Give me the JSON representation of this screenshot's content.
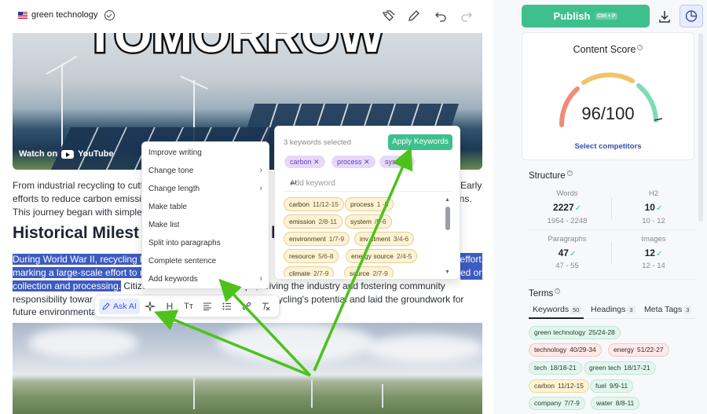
{
  "topbar": {
    "topic": "green technology"
  },
  "hero": {
    "sign_text": "TOMORROW",
    "watch_label": "Watch on",
    "youtube_label": "YouTube"
  },
  "article": {
    "intro_lines": [
      "From industrial recycling to cutti",
      "efforts to reduce carbon emissio",
      "This journey began with simple p"
    ],
    "intro_right": [
      "Early",
      "ons."
    ],
    "heading": "Historical Milest",
    "heading_tail": "l",
    "sel_lines": [
      "During World War II, recycling be",
      "marking a large-scale effort to m",
      "collection and processing."
    ],
    "sel_right": [
      "effort,",
      "ed on"
    ],
    "after_sel": " Citize",
    "line4_right": "pe, driving the industry and fostering community",
    "line5_left": "responsibility towar",
    "line5_right": "cycling's potential and laid the groundwork for",
    "line6_left": "future environmenta"
  },
  "toolbar": {
    "ask_ai_label": "Ask AI"
  },
  "context_menu": {
    "items": [
      {
        "label": "Improve writing",
        "submenu": false
      },
      {
        "label": "Change tone",
        "submenu": true
      },
      {
        "label": "Change length",
        "submenu": true
      },
      {
        "label": "Make table",
        "submenu": false
      },
      {
        "label": "Make list",
        "submenu": false
      },
      {
        "label": "Split into paragraphs",
        "submenu": false
      },
      {
        "label": "Complete sentence",
        "submenu": false
      },
      {
        "label": "Add keywords",
        "submenu": true
      }
    ]
  },
  "keywords_panel": {
    "count_text": "3 keywords selected",
    "apply_label": "Apply Keywords",
    "selected": [
      "carbon ✕",
      "process ✕",
      "syste ✕"
    ],
    "add_placeholder": "Add keyword",
    "chips": [
      {
        "name": "carbon",
        "range": "11/12-15"
      },
      {
        "name": "process",
        "range": "1 -5"
      },
      {
        "name": "emission",
        "range": "2/8-11"
      },
      {
        "name": "system",
        "range": "/5-6"
      },
      {
        "name": "environment",
        "range": "1/7-9"
      },
      {
        "name": "inv stment",
        "range": "3/4-6"
      },
      {
        "name": "resource",
        "range": "5/6-8"
      },
      {
        "name": "energy source",
        "range": "2/4-5"
      },
      {
        "name": "climate",
        "range": "2/7-9"
      },
      {
        "name": "source",
        "range": "2/7-9"
      }
    ]
  },
  "sidebar": {
    "publish_label": "Publish",
    "publish_shortcut": "Ctrl + P",
    "content_score_title": "Content Score",
    "score": "96/100",
    "competitors_label": "Select competitors",
    "structure_title": "Structure",
    "stats": [
      {
        "label": "Words",
        "value": "2227",
        "range": "1954 - 2248"
      },
      {
        "label": "H2",
        "value": "10",
        "range": "10 - 12"
      },
      {
        "label": "Paragraphs",
        "value": "47",
        "range": "47 - 55"
      },
      {
        "label": "Images",
        "value": "12",
        "range": "12 - 14"
      }
    ],
    "terms_title": "Terms",
    "tabs": [
      {
        "label": "Keywords",
        "badge": "50"
      },
      {
        "label": "Headings",
        "badge": "3"
      },
      {
        "label": "Meta Tags",
        "badge": "3"
      }
    ],
    "terms": [
      {
        "name": "green technology",
        "range": "25/24-28",
        "status": "green"
      },
      {
        "name": "technology",
        "range": "40/29-34",
        "status": "red"
      },
      {
        "name": "energy",
        "range": "51/22-27",
        "status": "red"
      },
      {
        "name": "tech",
        "range": "18/18-21",
        "status": "green"
      },
      {
        "name": "green tech",
        "range": "18/17-21",
        "status": "green"
      },
      {
        "name": "carbon",
        "range": "11/12-15",
        "status": "yellow"
      },
      {
        "name": "fuel",
        "range": "9/9-11",
        "status": "green"
      },
      {
        "name": "company",
        "range": "7/7-9",
        "status": "green"
      },
      {
        "name": "water",
        "range": "8/8-11",
        "status": "green"
      }
    ]
  },
  "colors": {
    "accent_green": "#3dbf8e",
    "selection_blue": "#3d5bc1",
    "arrow_green": "#4cc21a"
  }
}
